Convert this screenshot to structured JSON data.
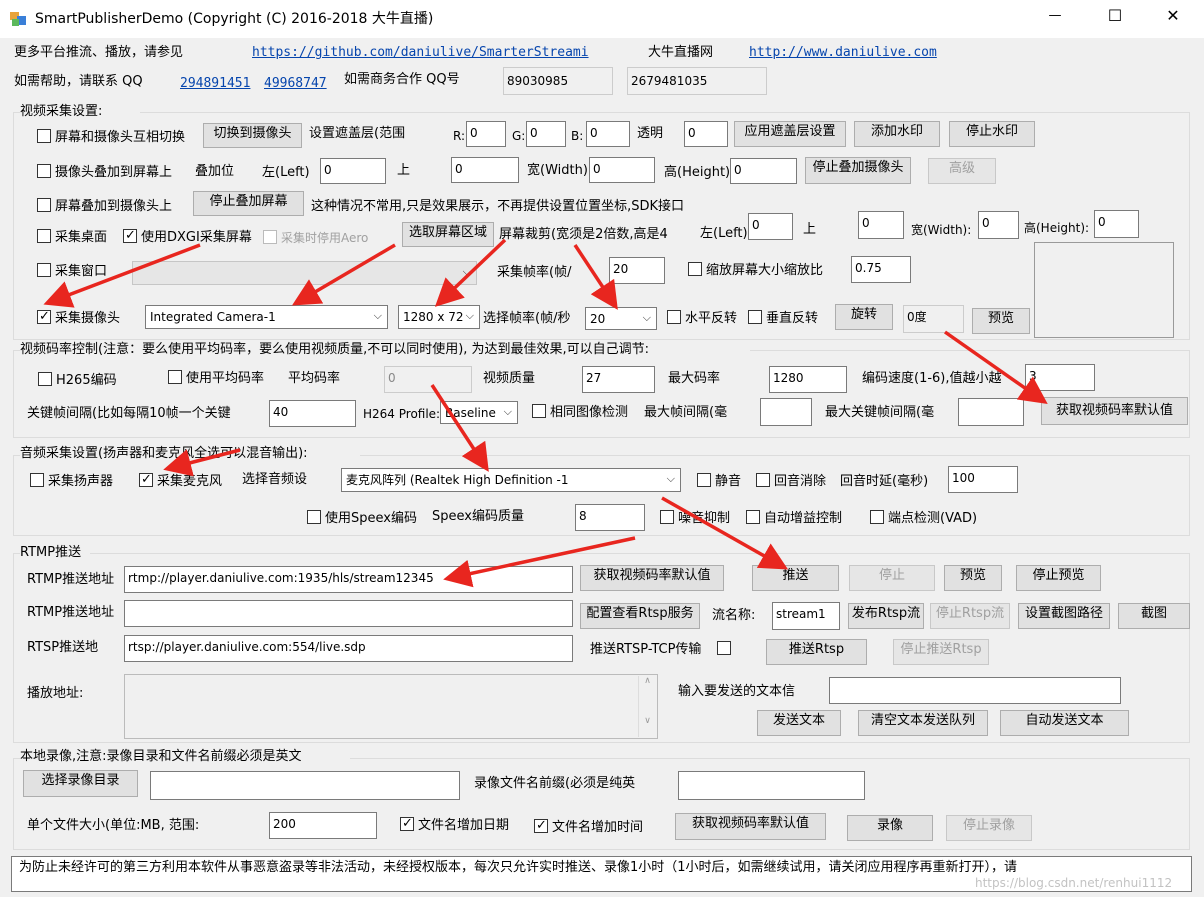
{
  "window": {
    "title": "SmartPublisherDemo  (Copyright (C) 2016-2018 大牛直播)",
    "min": "—",
    "max": "☐",
    "close": "✕"
  },
  "header": {
    "more": "更多平台推流、播放，请参见",
    "github": "https://github.com/daniulive/SmarterStreami",
    "brand": "大牛直播网",
    "site": "http://www.daniulive.com",
    "help": "如需帮助，请联系 QQ",
    "qq1": "294891451",
    "qq2": "49968747",
    "biz": "如需商务合作 QQ号",
    "biz1": "89030985",
    "biz2": "2679481035"
  },
  "video": {
    "title": "视频采集设置:",
    "overlay_mix": "屏幕和摄像头互相切换",
    "switch_cam": "切换到摄像头",
    "mask_lbl": "设置遮盖层(范围",
    "r": "R:",
    "rv": "0",
    "g": "G:",
    "gv": "0",
    "b": "B:",
    "bv": "0",
    "alpha": "透明",
    "alphav": "0",
    "apply_mask": "应用遮盖层设置",
    "add_wm": "添加水印",
    "stop_wm": "停止水印",
    "cam_on_screen": "摄像头叠加到屏幕上",
    "overlay_pos": "叠加位",
    "left": "左(Left)",
    "leftv": "0",
    "up": "上",
    "upv": "0",
    "width": "宽(Width)",
    "widthv": "0",
    "height": "高(Height)",
    "heightv": "0",
    "stop_cam_overlay": "停止叠加摄像头",
    "adv": "高级",
    "screen_on_cam": "屏幕叠加到摄像头上",
    "stop_screen_overlay": "停止叠加屏幕",
    "notice": "这种情况不常用,只是效果展示，不再提供设置位置坐标,SDK接口",
    "desktop": "采集桌面",
    "dxgi": "使用DXGI采集屏幕",
    "aero": "采集时停用Aero",
    "select_area": "选取屏幕区域",
    "crop": "屏幕裁剪(宽须是2倍数,高是4",
    "cleft": "左(Left):",
    "cleftv": "0",
    "cup": "上",
    "cupv": "0",
    "cwidth": "宽(Width):",
    "cwidthv": "0",
    "cheight": "高(Height):",
    "cheightv": "0",
    "window_cap": "采集窗口",
    "fps_lbl": "采集帧率(帧/",
    "fpsv": "20",
    "scale": "缩放屏幕大小缩放比",
    "scalev": "0.75",
    "camera": "采集摄像头",
    "camera_dev": "Integrated Camera-1",
    "res": "1280 x 72",
    "sel_fps": "选择帧率(帧/秒",
    "sel_fpsv": "20",
    "hflip": "水平反转",
    "vflip": "垂直反转",
    "rotate": "旋转",
    "rot_val": "0度",
    "preview": "预览"
  },
  "bitrate": {
    "title": "视频码率控制(注意：要么使用平均码率，要么使用视频质量,不可以同时使用), 为达到最佳效果,可以自己调节:",
    "h265": "H265编码",
    "avg": "使用平均码率",
    "avg_lbl": "平均码率",
    "avgv": "0",
    "quality": "视频质量",
    "qualityv": "27",
    "max": "最大码率",
    "maxv": "1280",
    "speed": "编码速度(1-6),值越小越",
    "speedv": "3",
    "gop": "关键帧间隔(比如每隔10帧一个关键",
    "gopv": "40",
    "profile": "H264 Profile:",
    "profilev": "Baseline",
    "same": "相同图像检测",
    "maxint": "最大帧间隔(毫",
    "maxkey": "最大关键帧间隔(毫",
    "get_default": "获取视频码率默认值"
  },
  "audio": {
    "title": "音频采集设置(扬声器和麦克风全选可以混音输出):",
    "speaker": "采集扬声器",
    "mic": "采集麦克风",
    "dev_lbl": "选择音频设",
    "dev": "麦克风阵列 (Realtek High Definition -1",
    "mute": "静音",
    "echo": "回音消除",
    "delay": "回音时延(毫秒)",
    "delayv": "100",
    "speex": "使用Speex编码",
    "speex_q": "Speex编码质量",
    "speex_qv": "8",
    "ns": "噪音抑制",
    "agc": "自动增益控制",
    "vad": "端点检测(VAD)"
  },
  "rtmp": {
    "title": "RTMP推送",
    "url_lbl": "RTMP推送地址",
    "url": "rtmp://player.daniulive.com:1935/hls/stream12345",
    "get_default": "获取视频码率默认值",
    "push": "推送",
    "stop": "停止",
    "preview": "预览",
    "stop_preview": "停止预览",
    "url2_lbl": "RTMP推送地址",
    "url2": "",
    "rtsp_cfg": "配置查看Rtsp服务",
    "stream_lbl": "流名称:",
    "stream": "stream1",
    "pub_rtsp": "发布Rtsp流",
    "stop_rtsp": "停止Rtsp流",
    "snap_path": "设置截图路径",
    "snap": "截图",
    "rtsp_lbl": "RTSP推送地",
    "rtsp": "rtsp://player.daniulive.com:554/live.sdp",
    "tcp": "推送RTSP-TCP传输",
    "push_rtsp": "推送Rtsp",
    "stop_push_rtsp": "停止推送Rtsp",
    "play_lbl": "播放地址:",
    "text_lbl": "输入要发送的文本信",
    "send": "发送文本",
    "clear": "清空文本发送队列",
    "auto": "自动发送文本"
  },
  "record": {
    "title": "本地录像,注意:录像目录和文件名前缀必须是英文",
    "dir_btn": "选择录像目录",
    "prefix": "录像文件名前缀(必须是纯英",
    "size_lbl": "单个文件大小(单位:MB, 范围:",
    "sizev": "200",
    "add_date": "文件名增加日期",
    "add_time": "文件名增加时间",
    "get_default": "获取视频码率默认值",
    "rec": "录像",
    "stop_rec": "停止录像"
  },
  "status": {
    "text": "为防止未经许可的第三方利用本软件从事恶意盗录等非法活动，未经授权版本，每次只允许实时推送、录像1小时（1小时后，如需继续试用，请关闭应用程序再重新打开），请",
    "watermark": "https://blog.csdn.net/renhui1112"
  },
  "colors": {
    "arrow": "#e8261f",
    "link": "#0645ad"
  }
}
